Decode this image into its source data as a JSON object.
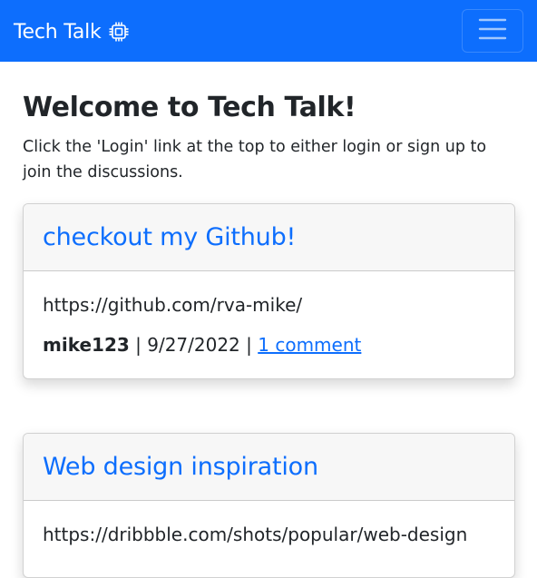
{
  "navbar": {
    "brand": "Tech Talk",
    "brand_icon": "cpu-chip-icon",
    "toggler_icon": "hamburger-menu-icon",
    "background": "#0d6efd"
  },
  "main": {
    "title": "Welcome to Tech Talk!",
    "intro": "Click the 'Login' link at the top to either login or sign up to join the discussions."
  },
  "posts": [
    {
      "title": "checkout my Github!",
      "url": "https://github.com/rva-mike/",
      "author": "mike123",
      "sep1": " | ",
      "date": "9/27/2022",
      "sep2": " | ",
      "comments": "1 comment"
    },
    {
      "title": "Web design inspiration",
      "url": "https://dribbble.com/shots/popular/web-design"
    }
  ],
  "colors": {
    "link": "#0d6efd",
    "text": "#212529",
    "card_header_bg": "#f7f7f7"
  }
}
